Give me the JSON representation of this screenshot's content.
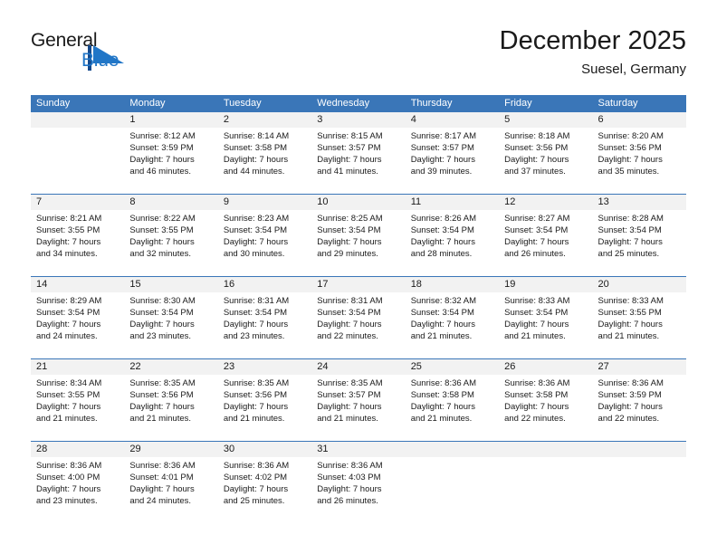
{
  "brand": {
    "name_part1": "General",
    "name_part2": "Blue",
    "logo_icon": "triangle-flag-icon",
    "accent_color": "#2176c7"
  },
  "header": {
    "title": "December 2025",
    "subtitle": "Suesel, Germany"
  },
  "theme": {
    "header_bg": "#3a76b8",
    "daynum_bg": "#f2f2f2",
    "week_divider": "#3a76b8",
    "text": "#1a1a1a"
  },
  "weekdays": [
    "Sunday",
    "Monday",
    "Tuesday",
    "Wednesday",
    "Thursday",
    "Friday",
    "Saturday"
  ],
  "weeks": [
    [
      {
        "day": "",
        "lines": []
      },
      {
        "day": "1",
        "lines": [
          "Sunrise: 8:12 AM",
          "Sunset: 3:59 PM",
          "Daylight: 7 hours",
          "and 46 minutes."
        ]
      },
      {
        "day": "2",
        "lines": [
          "Sunrise: 8:14 AM",
          "Sunset: 3:58 PM",
          "Daylight: 7 hours",
          "and 44 minutes."
        ]
      },
      {
        "day": "3",
        "lines": [
          "Sunrise: 8:15 AM",
          "Sunset: 3:57 PM",
          "Daylight: 7 hours",
          "and 41 minutes."
        ]
      },
      {
        "day": "4",
        "lines": [
          "Sunrise: 8:17 AM",
          "Sunset: 3:57 PM",
          "Daylight: 7 hours",
          "and 39 minutes."
        ]
      },
      {
        "day": "5",
        "lines": [
          "Sunrise: 8:18 AM",
          "Sunset: 3:56 PM",
          "Daylight: 7 hours",
          "and 37 minutes."
        ]
      },
      {
        "day": "6",
        "lines": [
          "Sunrise: 8:20 AM",
          "Sunset: 3:56 PM",
          "Daylight: 7 hours",
          "and 35 minutes."
        ]
      }
    ],
    [
      {
        "day": "7",
        "lines": [
          "Sunrise: 8:21 AM",
          "Sunset: 3:55 PM",
          "Daylight: 7 hours",
          "and 34 minutes."
        ]
      },
      {
        "day": "8",
        "lines": [
          "Sunrise: 8:22 AM",
          "Sunset: 3:55 PM",
          "Daylight: 7 hours",
          "and 32 minutes."
        ]
      },
      {
        "day": "9",
        "lines": [
          "Sunrise: 8:23 AM",
          "Sunset: 3:54 PM",
          "Daylight: 7 hours",
          "and 30 minutes."
        ]
      },
      {
        "day": "10",
        "lines": [
          "Sunrise: 8:25 AM",
          "Sunset: 3:54 PM",
          "Daylight: 7 hours",
          "and 29 minutes."
        ]
      },
      {
        "day": "11",
        "lines": [
          "Sunrise: 8:26 AM",
          "Sunset: 3:54 PM",
          "Daylight: 7 hours",
          "and 28 minutes."
        ]
      },
      {
        "day": "12",
        "lines": [
          "Sunrise: 8:27 AM",
          "Sunset: 3:54 PM",
          "Daylight: 7 hours",
          "and 26 minutes."
        ]
      },
      {
        "day": "13",
        "lines": [
          "Sunrise: 8:28 AM",
          "Sunset: 3:54 PM",
          "Daylight: 7 hours",
          "and 25 minutes."
        ]
      }
    ],
    [
      {
        "day": "14",
        "lines": [
          "Sunrise: 8:29 AM",
          "Sunset: 3:54 PM",
          "Daylight: 7 hours",
          "and 24 minutes."
        ]
      },
      {
        "day": "15",
        "lines": [
          "Sunrise: 8:30 AM",
          "Sunset: 3:54 PM",
          "Daylight: 7 hours",
          "and 23 minutes."
        ]
      },
      {
        "day": "16",
        "lines": [
          "Sunrise: 8:31 AM",
          "Sunset: 3:54 PM",
          "Daylight: 7 hours",
          "and 23 minutes."
        ]
      },
      {
        "day": "17",
        "lines": [
          "Sunrise: 8:31 AM",
          "Sunset: 3:54 PM",
          "Daylight: 7 hours",
          "and 22 minutes."
        ]
      },
      {
        "day": "18",
        "lines": [
          "Sunrise: 8:32 AM",
          "Sunset: 3:54 PM",
          "Daylight: 7 hours",
          "and 21 minutes."
        ]
      },
      {
        "day": "19",
        "lines": [
          "Sunrise: 8:33 AM",
          "Sunset: 3:54 PM",
          "Daylight: 7 hours",
          "and 21 minutes."
        ]
      },
      {
        "day": "20",
        "lines": [
          "Sunrise: 8:33 AM",
          "Sunset: 3:55 PM",
          "Daylight: 7 hours",
          "and 21 minutes."
        ]
      }
    ],
    [
      {
        "day": "21",
        "lines": [
          "Sunrise: 8:34 AM",
          "Sunset: 3:55 PM",
          "Daylight: 7 hours",
          "and 21 minutes."
        ]
      },
      {
        "day": "22",
        "lines": [
          "Sunrise: 8:35 AM",
          "Sunset: 3:56 PM",
          "Daylight: 7 hours",
          "and 21 minutes."
        ]
      },
      {
        "day": "23",
        "lines": [
          "Sunrise: 8:35 AM",
          "Sunset: 3:56 PM",
          "Daylight: 7 hours",
          "and 21 minutes."
        ]
      },
      {
        "day": "24",
        "lines": [
          "Sunrise: 8:35 AM",
          "Sunset: 3:57 PM",
          "Daylight: 7 hours",
          "and 21 minutes."
        ]
      },
      {
        "day": "25",
        "lines": [
          "Sunrise: 8:36 AM",
          "Sunset: 3:58 PM",
          "Daylight: 7 hours",
          "and 21 minutes."
        ]
      },
      {
        "day": "26",
        "lines": [
          "Sunrise: 8:36 AM",
          "Sunset: 3:58 PM",
          "Daylight: 7 hours",
          "and 22 minutes."
        ]
      },
      {
        "day": "27",
        "lines": [
          "Sunrise: 8:36 AM",
          "Sunset: 3:59 PM",
          "Daylight: 7 hours",
          "and 22 minutes."
        ]
      }
    ],
    [
      {
        "day": "28",
        "lines": [
          "Sunrise: 8:36 AM",
          "Sunset: 4:00 PM",
          "Daylight: 7 hours",
          "and 23 minutes."
        ]
      },
      {
        "day": "29",
        "lines": [
          "Sunrise: 8:36 AM",
          "Sunset: 4:01 PM",
          "Daylight: 7 hours",
          "and 24 minutes."
        ]
      },
      {
        "day": "30",
        "lines": [
          "Sunrise: 8:36 AM",
          "Sunset: 4:02 PM",
          "Daylight: 7 hours",
          "and 25 minutes."
        ]
      },
      {
        "day": "31",
        "lines": [
          "Sunrise: 8:36 AM",
          "Sunset: 4:03 PM",
          "Daylight: 7 hours",
          "and 26 minutes."
        ]
      },
      {
        "day": "",
        "lines": []
      },
      {
        "day": "",
        "lines": []
      },
      {
        "day": "",
        "lines": []
      }
    ]
  ]
}
